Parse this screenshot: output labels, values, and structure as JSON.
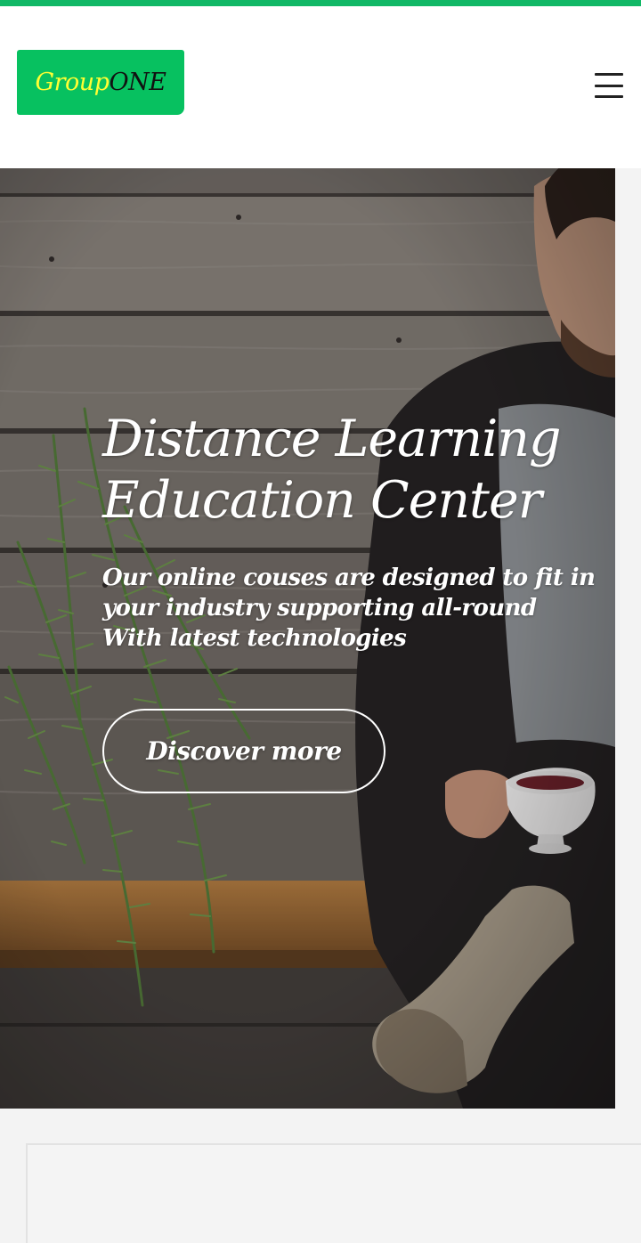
{
  "header": {
    "logo": {
      "part1": "Group",
      "part2": "ONE"
    },
    "menu_icon": "hamburger-menu-icon"
  },
  "hero": {
    "title_line1": "Distance Learning",
    "title_line2": "Education Center",
    "subtitle_line1": "Our online couses are designed to fit in",
    "subtitle_line2": "your industry supporting all-round",
    "subtitle_line3": "With latest technologies",
    "button_label": "Discover more",
    "background_image": "man-sitting-on-bench-with-cup-and-rosemary-plant"
  },
  "colors": {
    "accent_green": "#07c160",
    "top_strip": "#11b866",
    "logo_text_primary": "#ffff33",
    "logo_text_secondary": "#111111",
    "hero_text": "#ffffff",
    "page_background": "#f3f3f3"
  }
}
